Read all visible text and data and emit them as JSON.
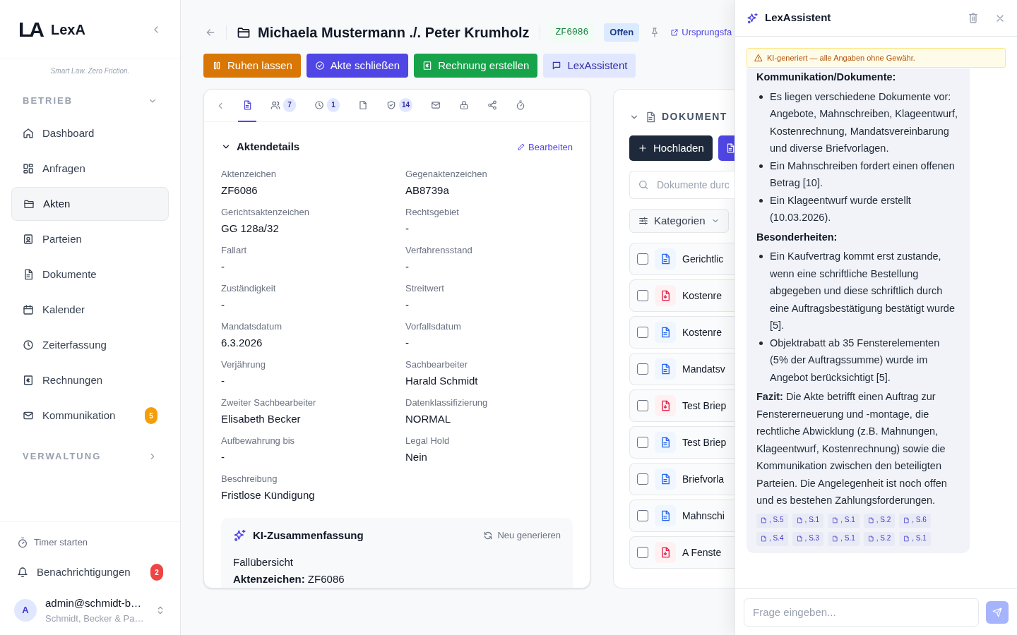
{
  "brand": {
    "logo": "LA",
    "name": "LexA",
    "tagline": "Smart Law. Zero Friction."
  },
  "sidebar": {
    "sections": [
      {
        "title": "BETRIEB",
        "expanded": true,
        "items": [
          {
            "label": "Dashboard",
            "selected": false
          },
          {
            "label": "Anfragen",
            "selected": false
          },
          {
            "label": "Akten",
            "selected": true
          },
          {
            "label": "Parteien",
            "selected": false
          },
          {
            "label": "Dokumente",
            "selected": false
          },
          {
            "label": "Kalender",
            "selected": false
          },
          {
            "label": "Zeiterfassung",
            "selected": false
          },
          {
            "label": "Rechnungen",
            "selected": false
          },
          {
            "label": "Kommunikation",
            "selected": false,
            "badge": "5"
          }
        ]
      },
      {
        "title": "VERWALTUNG",
        "expanded": false
      }
    ],
    "timer": "Timer starten",
    "notifications": {
      "label": "Benachrichtigungen",
      "badge": "2"
    },
    "user": {
      "avatar": "A",
      "email": "admin@schmidt-b…",
      "org": "Schmidt, Becker & Pa…"
    }
  },
  "header": {
    "title": "Michaela Mustermann ./. Peter Krumholz",
    "tag": "ZF6086",
    "status": "Offen",
    "link": "Ursprungsfa"
  },
  "actions": [
    {
      "label": "Ruhen lassen",
      "kind": "warning"
    },
    {
      "label": "Akte schließen",
      "kind": "primary"
    },
    {
      "label": "Rechnung erstellen",
      "kind": "success"
    },
    {
      "label": "LexAssistent",
      "kind": "soft"
    }
  ],
  "detail_tabs": [
    {
      "selected": true
    },
    {
      "count": "7",
      "selected": false
    },
    {
      "count": "1",
      "selected": false
    },
    {
      "selected": false
    },
    {
      "count": "14",
      "selected": false
    },
    {
      "selected": false
    },
    {
      "selected": false
    },
    {
      "selected": false
    },
    {
      "selected": false
    }
  ],
  "details": {
    "title": "Aktendetails",
    "expanded": true,
    "edit": "Bearbeiten",
    "fields": [
      {
        "label": "Aktenzeichen",
        "value": "ZF6086"
      },
      {
        "label": "Gegenaktenzeichen",
        "value": "AB8739a"
      },
      {
        "label": "Gerichtsaktenzeichen",
        "value": "GG 128a/32"
      },
      {
        "label": "Rechtsgebiet",
        "value": "-"
      },
      {
        "label": "Fallart",
        "value": "-"
      },
      {
        "label": "Verfahrensstand",
        "value": "-"
      },
      {
        "label": "Zuständigkeit",
        "value": "-"
      },
      {
        "label": "Streitwert",
        "value": "-"
      },
      {
        "label": "Mandatsdatum",
        "value": "6.3.2026"
      },
      {
        "label": "Vorfallsdatum",
        "value": "-"
      },
      {
        "label": "Verjährung",
        "value": "-"
      },
      {
        "label": "Sachbearbeiter",
        "value": "Harald Schmidt"
      },
      {
        "label": "Zweiter Sachbearbeiter",
        "value": "Elisabeth Becker"
      },
      {
        "label": "Datenklassifizierung",
        "value": "NORMAL"
      },
      {
        "label": "Aufbewahrung bis",
        "value": "-"
      },
      {
        "label": "Legal Hold",
        "value": "Nein"
      },
      {
        "label": "Beschreibung",
        "value": "Fristlose Kündigung"
      }
    ]
  },
  "summary": {
    "title": "KI-Zusammenfassung",
    "regenerate": "Neu generieren",
    "lines": [
      "Fallübersicht",
      "**Aktenzeichen:** ZF6086"
    ]
  },
  "documents": {
    "title": "DOKUMENT",
    "expanded": true,
    "upload": "Hochladen",
    "search_placeholder": "Dokumente durc",
    "filter": "Kategorien",
    "rows": [
      {
        "name": "Gerichtlic",
        "kind": "doc",
        "checked": false
      },
      {
        "name": "Kostenre",
        "kind": "pdf",
        "checked": false
      },
      {
        "name": "Kostenre",
        "kind": "doc",
        "checked": false
      },
      {
        "name": "Mandatsv",
        "kind": "doc",
        "checked": false
      },
      {
        "name": "Test Briep",
        "kind": "pdf",
        "checked": false
      },
      {
        "name": "Test Briep",
        "kind": "doc",
        "checked": false
      },
      {
        "name": "Briefvorla",
        "kind": "doc",
        "checked": false
      },
      {
        "name": "Mahnschi",
        "kind": "doc",
        "checked": false
      },
      {
        "name": "A Fenste",
        "kind": "pdf",
        "checked": false
      }
    ]
  },
  "assistant": {
    "title": "LexAssistent",
    "warning": "KI-generiert — alle Angaben ohne Gewähr.",
    "blocks": [
      {
        "kind": "heading",
        "text": "Kommunikation/Dokumente:"
      },
      {
        "kind": "list",
        "items": [
          "Es liegen verschiedene Dokumente vor: Angebote, Mahnschreiben, Klageentwurf, Kostenrechnung, Mandatsvereinbarung und diverse Briefvorlagen.",
          "Ein Mahnschreiben fordert einen offenen Betrag [10].",
          "Ein Klageentwurf wurde erstellt (10.03.2026)."
        ]
      },
      {
        "kind": "heading",
        "text": "Besonderheiten:"
      },
      {
        "kind": "list",
        "items": [
          "Ein Kaufvertrag kommt erst zustande, wenn eine schriftliche Bestellung abgegeben und diese schriftlich durch eine Auftragsbestätigung bestätigt wurde [5].",
          "Objektrabatt ab 35 Fensterelementen (5% der Auftragssumme) wurde im Angebot berücksichtigt [5]."
        ]
      },
      {
        "kind": "paragraph",
        "text": "**Fazit:** Die Akte betrifft einen Auftrag zur Fenstererneuerung und -montage, die rechtliche Abwicklung (z.B. Mahnungen, Klageentwurf, Kostenrechnung) sowie die Kommunikation zwischen den beteiligten Parteien. Die Angelegenheit ist noch offen und es bestehen Zahlungsforderungen."
      }
    ],
    "citations": [
      ", S.5",
      ", S.1",
      ", S.1",
      ", S.2",
      ", S.6",
      ", S.4",
      ", S.3",
      ", S.1",
      ", S.2",
      ", S.1"
    ],
    "input_placeholder": "Frage eingeben..."
  }
}
